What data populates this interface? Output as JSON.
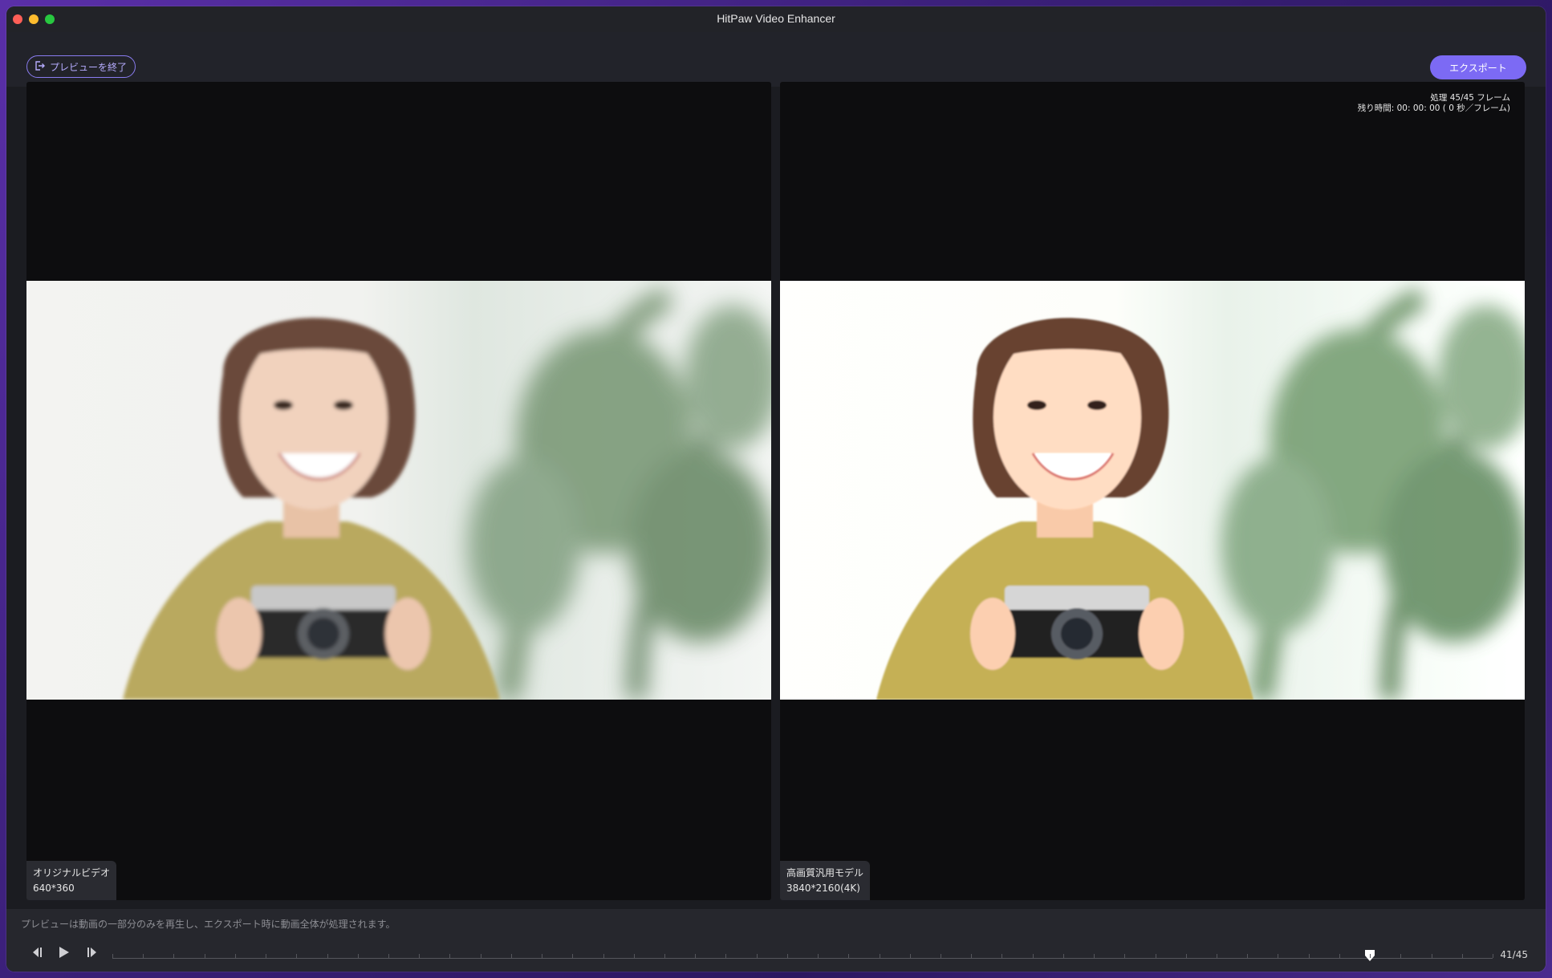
{
  "window": {
    "title": "HitPaw Video Enhancer"
  },
  "toolbar": {
    "exit_label": "プレビューを終了",
    "export_label": "エクスポート"
  },
  "left_panel": {
    "label": "オリジナルビデオ",
    "resolution": "640*360"
  },
  "right_panel": {
    "label": "高画質汎用モデル",
    "resolution": "3840*2160(4K)",
    "progress_text": "処理 45/45 フレーム",
    "remaining_text": "残り時間: 00: 00: 00 ( 0 秒／フレーム)"
  },
  "bottom": {
    "note": "プレビューは動画の一部分のみを再生し、エクスポート時に動画全体が処理されます。"
  },
  "timeline": {
    "current_frame": 41,
    "total_frames": 45,
    "counter_text": "41/45"
  },
  "colors": {
    "accent": "#7c6af4",
    "panel_bg": "#0d0d0f",
    "window_bg": "#1b1c21"
  }
}
